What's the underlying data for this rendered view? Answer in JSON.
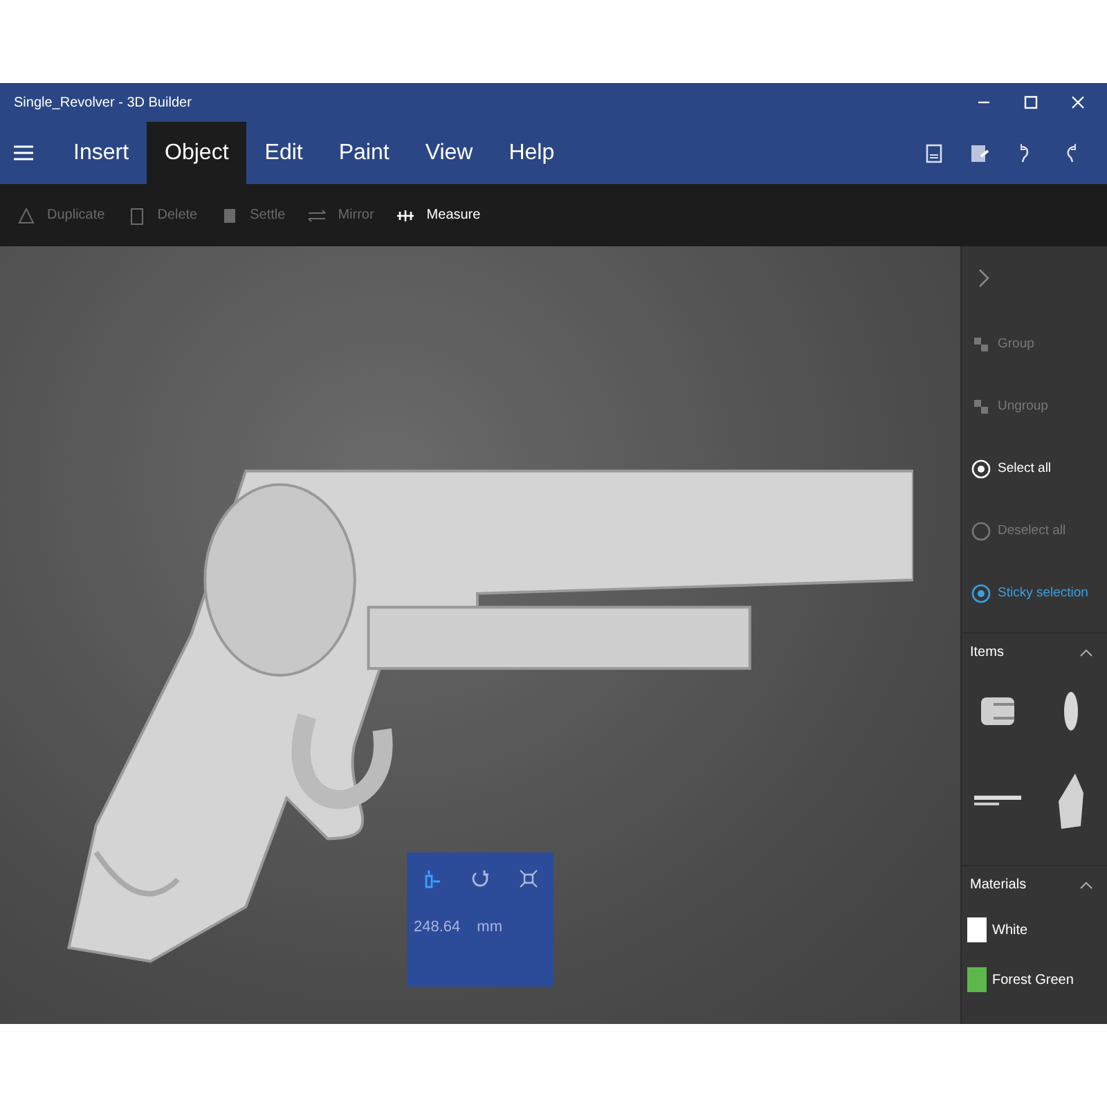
{
  "window": {
    "title": "Single_Revolver - 3D Builder"
  },
  "tabs": [
    {
      "label": "Insert",
      "selected": false
    },
    {
      "label": "Object",
      "selected": true
    },
    {
      "label": "Edit",
      "selected": false
    },
    {
      "label": "Paint",
      "selected": false
    },
    {
      "label": "View",
      "selected": false
    },
    {
      "label": "Help",
      "selected": false
    }
  ],
  "toolbar": [
    {
      "label": "Duplicate",
      "kind": "duplicate",
      "disabled": true
    },
    {
      "label": "Delete",
      "kind": "delete",
      "disabled": true
    },
    {
      "label": "Settle",
      "kind": "settle",
      "disabled": true
    },
    {
      "label": "Mirror",
      "kind": "mirror",
      "disabled": true
    },
    {
      "label": "Measure",
      "kind": "measure",
      "disabled": false
    }
  ],
  "side_panel": {
    "actions": [
      {
        "label": "Group",
        "kind": "group",
        "disabled": true,
        "on": false
      },
      {
        "label": "Ungroup",
        "kind": "ungroup",
        "disabled": true,
        "on": false
      },
      {
        "label": "Select all",
        "kind": "select",
        "disabled": false,
        "on": false
      },
      {
        "label": "Deselect all",
        "kind": "deselect",
        "disabled": true,
        "on": false
      },
      {
        "label": "Sticky selection",
        "kind": "sticky",
        "disabled": false,
        "on": true
      }
    ],
    "items": {
      "title": "Items"
    },
    "materials": {
      "title": "Materials",
      "list": [
        {
          "label": "White",
          "color": "#ffffff"
        },
        {
          "label": "Forest Green",
          "color": "#5cb84a"
        }
      ]
    }
  },
  "measure_box": {
    "modes": [
      {
        "kind": "scale",
        "selected": true
      },
      {
        "kind": "rotate",
        "selected": false
      },
      {
        "kind": "fit",
        "selected": false
      }
    ],
    "value": "248.64",
    "unit": "mm"
  }
}
